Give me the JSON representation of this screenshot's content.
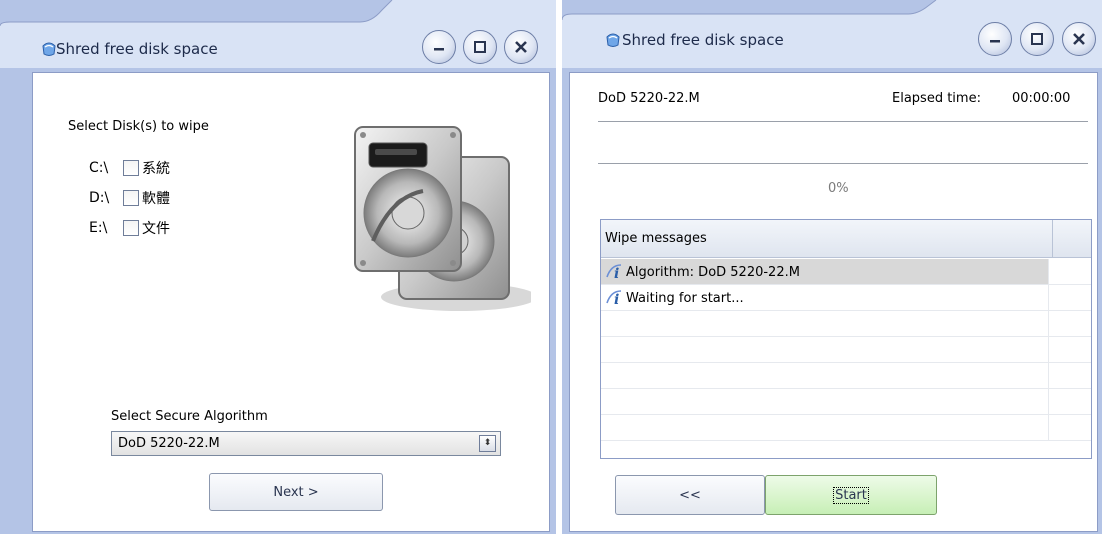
{
  "left_window": {
    "title": "Shred free disk space",
    "select_disks_label": "Select Disk(s) to wipe",
    "disks": [
      {
        "drive": "C:\\",
        "name": "系統",
        "checked": false
      },
      {
        "drive": "D:\\",
        "name": "軟體",
        "checked": false
      },
      {
        "drive": "E:\\",
        "name": "文件",
        "checked": false
      }
    ],
    "algorithm_label": "Select Secure Algorithm",
    "algorithm_value": "DoD 5220-22.M",
    "next_label": "Next >"
  },
  "right_window": {
    "title": "Shred free disk space",
    "algorithm": "DoD 5220-22.M",
    "elapsed_label": "Elapsed time:",
    "elapsed_value": "00:00:00",
    "progress_text": "0%",
    "progress": 0,
    "messages_header": "Wipe messages",
    "messages": [
      "Algorithm: DoD 5220-22.M",
      "Waiting for start..."
    ],
    "back_label": "<<",
    "start_label": "Start"
  },
  "icons": [
    "shred-app-icon",
    "minimize-icon",
    "maximize-icon",
    "close-icon",
    "hard-drive-icon",
    "info-icon",
    "spinner-arrows-icon"
  ],
  "colors": {
    "frame": "#b4c4e6",
    "start_button": "#c7efb6",
    "selected_row": "#d8d8d8"
  }
}
